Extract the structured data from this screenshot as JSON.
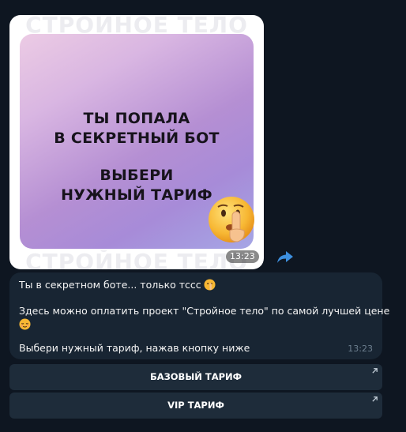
{
  "photo": {
    "watermark_text": "СТРОЙНОЕ ТЕЛО",
    "headline_lines": [
      "ТЫ ПОПАЛА",
      "В СЕКРЕТНЫЙ БОТ",
      "ВЫБЕРИ",
      "НУЖНЫЙ ТАРИФ"
    ],
    "emoji": "shushing-face-icon",
    "time": "13:23"
  },
  "message": {
    "line1": "Ты в секретном боте... только тссс",
    "line2": "Здесь можно оплатить проект \"Стройное тело\" по самой лучшей цене",
    "line3": "Выбери нужный тариф, нажав кнопку ниже",
    "time": "13:23",
    "emojis": [
      "shushing-face-icon",
      "relieved-face-icon"
    ]
  },
  "buttons": [
    {
      "label": "БАЗОВЫЙ ТАРИФ",
      "icon": "external-arrow-icon"
    },
    {
      "label": "VIP ТАРИФ",
      "icon": "external-arrow-icon"
    }
  ],
  "colors": {
    "background": "#0e1621",
    "bubble": "#182533",
    "button": "#1e2c3a",
    "accent": "#3d8fde"
  }
}
